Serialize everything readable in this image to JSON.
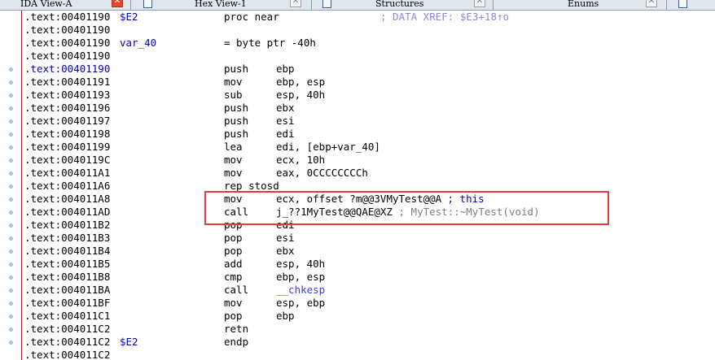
{
  "tabs": [
    {
      "label": "IDA View-A"
    },
    {
      "label": "Hex View-1"
    },
    {
      "label": "Structures"
    },
    {
      "label": "Enums"
    }
  ],
  "close_glyph": "✕",
  "icons": {
    "tab_icon": "window-icon",
    "breakpoint_dot": "breakpoint-dot-icon"
  },
  "colors": {
    "label": "#0000c8",
    "highlight_box": "#e23b3b",
    "gutter_line": "#d40000",
    "comment": "#7f7f7f"
  },
  "listing": [
    {
      "addr": ".text:00401190",
      "label": "$E2",
      "mnemonic": "proc near",
      "operands": "",
      "xref": "; DATA XREF: $E3+18↑o"
    },
    {
      "addr": ".text:00401190"
    },
    {
      "addr": ".text:00401190",
      "label": "var_40",
      "mnemonic": "= byte ptr -40h"
    },
    {
      "addr": ".text:00401190"
    },
    {
      "addr": ".text:00401190",
      "mnemonic": "push",
      "operands": "ebp"
    },
    {
      "addr": ".text:00401191",
      "mnemonic": "mov",
      "operands": "ebp, esp"
    },
    {
      "addr": ".text:00401193",
      "mnemonic": "sub",
      "operands": "esp, 40h"
    },
    {
      "addr": ".text:00401196",
      "mnemonic": "push",
      "operands": "ebx"
    },
    {
      "addr": ".text:00401197",
      "mnemonic": "push",
      "operands": "esi"
    },
    {
      "addr": ".text:00401198",
      "mnemonic": "push",
      "operands": "edi"
    },
    {
      "addr": ".text:00401199",
      "mnemonic": "lea",
      "operands": "edi, [ebp+var_40]"
    },
    {
      "addr": ".text:0040119C",
      "mnemonic": "mov",
      "operands": "ecx, 10h"
    },
    {
      "addr": ".text:004011A1",
      "mnemonic": "mov",
      "operands": "eax, 0CCCCCCCCh"
    },
    {
      "addr": ".text:004011A6",
      "mnemonic": "rep stosd"
    },
    {
      "addr": ".text:004011A8",
      "mnemonic": "mov",
      "operands": "ecx, offset ?m@@3VMyTest@@A",
      "comment": "; this"
    },
    {
      "addr": ".text:004011AD",
      "mnemonic": "call",
      "operands": "j_??1MyTest@@QAE@XZ",
      "comment": "; MyTest::~MyTest(void)"
    },
    {
      "addr": ".text:004011B2",
      "mnemonic": "pop",
      "operands": "edi"
    },
    {
      "addr": ".text:004011B3",
      "mnemonic": "pop",
      "operands": "esi"
    },
    {
      "addr": ".text:004011B4",
      "mnemonic": "pop",
      "operands": "ebx"
    },
    {
      "addr": ".text:004011B5",
      "mnemonic": "add",
      "operands": "esp, 40h"
    },
    {
      "addr": ".text:004011B8",
      "mnemonic": "cmp",
      "operands": "ebp, esp"
    },
    {
      "addr": ".text:004011BA",
      "mnemonic": "call",
      "operands": "__chkesp"
    },
    {
      "addr": ".text:004011BF",
      "mnemonic": "mov",
      "operands": "esp, ebp"
    },
    {
      "addr": ".text:004011C1",
      "mnemonic": "pop",
      "operands": "ebp"
    },
    {
      "addr": ".text:004011C2",
      "mnemonic": "retn"
    },
    {
      "addr": ".text:004011C2",
      "label": "$E2",
      "mnemonic": "endp"
    },
    {
      "addr": ".text:004011C2"
    }
  ]
}
